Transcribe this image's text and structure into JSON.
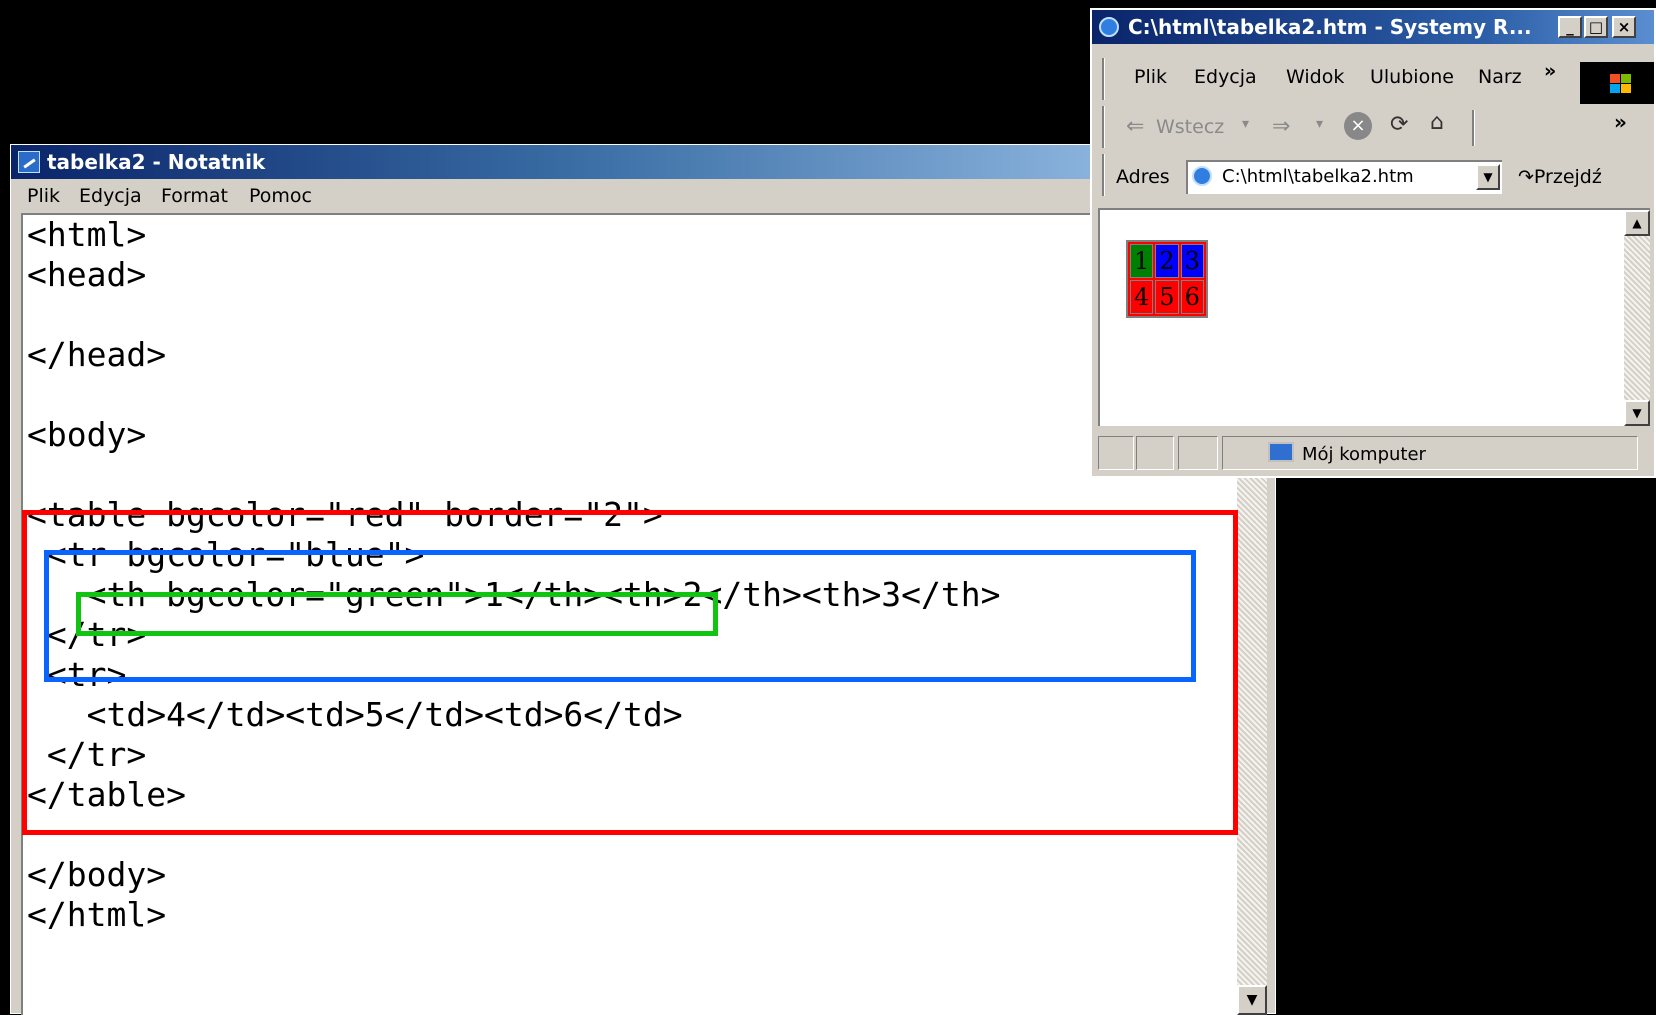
{
  "notepad": {
    "title": "tabelka2 - Notatnik",
    "menu": [
      "Plik",
      "Edycja",
      "Format",
      "Pomoc"
    ],
    "code": "<html>\n<head>\n\n</head>\n\n<body>\n\n<table bgcolor=\"red\" border=\"2\">\n <tr bgcolor=\"blue\">\n   <th bgcolor=\"green\">1</th><th>2</th><th>3</th>\n </tr>\n <tr>\n   <td>4</td><td>5</td><td>6</td>\n </tr>\n</table>\n\n</body>\n</html>"
  },
  "highlights": {
    "table_box": "#ff0000",
    "row_box": "#0a64ff",
    "cell_box": "#11c411"
  },
  "ie": {
    "title": "C:\\html\\tabelka2.htm - Systemy R...",
    "menu": [
      "Plik",
      "Edycja",
      "Widok",
      "Ulubione",
      "Narz"
    ],
    "menu_more": "»",
    "toolbar": {
      "back_label": "Wstecz",
      "more": "»"
    },
    "address_label": "Adres",
    "address_value": "C:\\html\\tabelka2.htm",
    "go_label": "Przejdź",
    "status_text": "Mój komputer",
    "table": {
      "row1": [
        "1",
        "2",
        "3"
      ],
      "row2": [
        "4",
        "5",
        "6"
      ],
      "colors": {
        "table_bg": "#ff0000",
        "row1_bg": "#0000ff",
        "first_cell_bg": "#008000"
      }
    }
  }
}
